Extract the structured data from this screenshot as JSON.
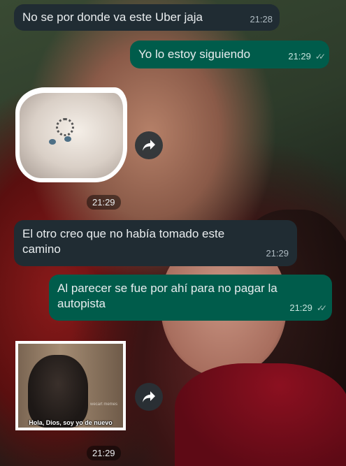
{
  "chat": {
    "messages": [
      {
        "id": "m1",
        "direction": "incoming",
        "type": "text",
        "text": "No se por donde va este Uber jaja",
        "time": "21:28"
      },
      {
        "id": "m2",
        "direction": "outgoing",
        "type": "text",
        "text": "Yo lo estoy siguiendo",
        "time": "21:29",
        "status": "read"
      },
      {
        "id": "m3",
        "direction": "incoming",
        "type": "sticker",
        "time": "21:29",
        "sticker_icon": "white-kitten-sticker-icon"
      },
      {
        "id": "m4",
        "direction": "incoming",
        "type": "text",
        "text": "El otro creo que no había tomado este camino",
        "time": "21:29"
      },
      {
        "id": "m5",
        "direction": "outgoing",
        "type": "text",
        "text": "Al parecer se fue por ahí para no pagar la autopista",
        "time": "21:29",
        "status": "read"
      },
      {
        "id": "m6",
        "direction": "incoming",
        "type": "image",
        "time": "21:29",
        "caption": "Hola, Dios, soy yo de nuevo",
        "watermark": "wecart memes"
      }
    ]
  },
  "icons": {
    "forward": "forward-arrow-icon",
    "read_ticks": "double-check-icon"
  },
  "colors": {
    "incoming_bubble": "#202c33",
    "outgoing_bubble": "#005c4b",
    "text": "#e9edef",
    "ticks": "#a0c4bc"
  }
}
